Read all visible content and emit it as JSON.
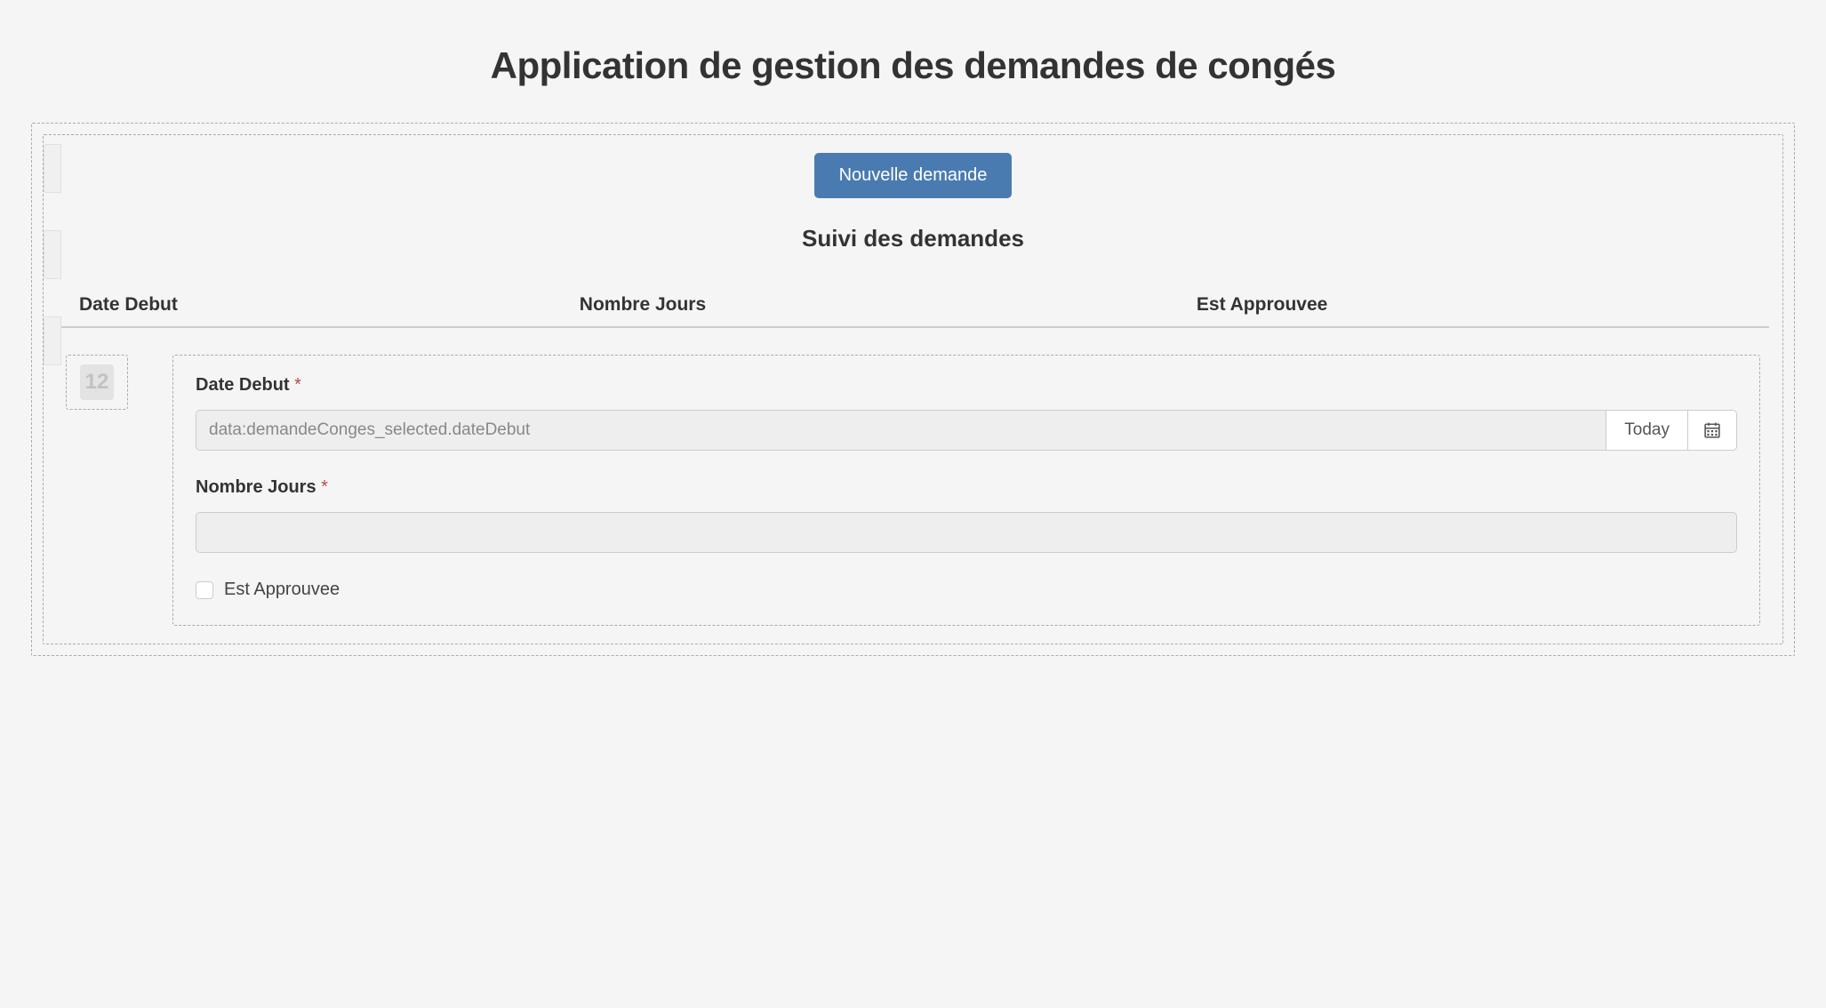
{
  "header": {
    "title": "Application de gestion des demandes de congés"
  },
  "main": {
    "new_request_label": "Nouvelle demande",
    "tracking_title": "Suivi des demandes",
    "columns": {
      "date_debut": "Date Debut",
      "nombre_jours": "Nombre Jours",
      "est_approuvee": "Est Approuvee"
    },
    "badge_number": "12"
  },
  "form": {
    "date_debut": {
      "label": "Date Debut",
      "value": "data:demandeConges_selected.dateDebut",
      "today_label": "Today"
    },
    "nombre_jours": {
      "label": "Nombre Jours",
      "value": ""
    },
    "est_approuvee": {
      "label": "Est Approuvee",
      "checked": false
    }
  }
}
